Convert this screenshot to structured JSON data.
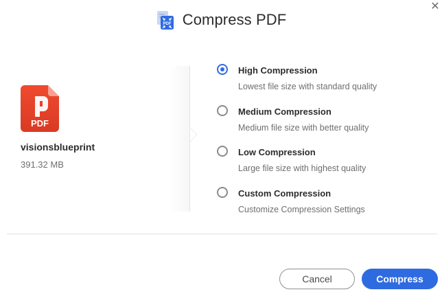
{
  "dialog": {
    "title": "Compress PDF",
    "close_symbol": "✕",
    "icons": {
      "header": "compress-pdf-icon",
      "close": "close-icon",
      "file": "pdf-file-icon"
    }
  },
  "file": {
    "type_label": "PDF",
    "name": "visionsblueprint",
    "size": "391.32 MB"
  },
  "options": [
    {
      "label": "High Compression",
      "description": "Lowest file size with standard quality",
      "selected": true
    },
    {
      "label": "Medium Compression",
      "description": "Medium file size with better quality",
      "selected": false
    },
    {
      "label": "Low Compression",
      "description": "Large file size with highest quality",
      "selected": false
    },
    {
      "label": "Custom Compression",
      "description": "Customize Compression Settings",
      "selected": false
    }
  ],
  "buttons": {
    "cancel_label": "Cancel",
    "compress_label": "Compress"
  },
  "colors": {
    "accent": "#2f6be0",
    "pdf_red": "#e8442f",
    "text_primary": "#2c2c2c",
    "text_secondary": "#6e6e6e"
  }
}
